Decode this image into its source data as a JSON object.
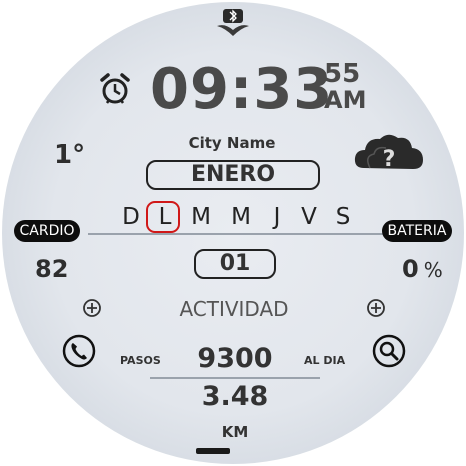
{
  "time": {
    "hours_minutes": "09:33",
    "seconds": "55",
    "ampm": "AM"
  },
  "weather": {
    "temperature": "1°",
    "city": "City Name",
    "icon": "cloud-question-icon"
  },
  "date": {
    "month": "ENERO",
    "weekdays": [
      "D",
      "L",
      "M",
      "M",
      "J",
      "V",
      "S"
    ],
    "active_weekday_index": 1,
    "day": "01"
  },
  "heart": {
    "label": "CARDIO",
    "value": "82"
  },
  "battery": {
    "label": "BATERIA",
    "value": "0",
    "unit": "%"
  },
  "activity": {
    "title": "ACTIVIDAD"
  },
  "steps": {
    "label": "PASOS",
    "value": "9300",
    "suffix": "AL DIA"
  },
  "distance": {
    "value": "3.48",
    "unit": "KM"
  },
  "colors": {
    "accent_ring": "#d01818",
    "dial": "#e4e8ee",
    "text": "#2e2e2e"
  }
}
